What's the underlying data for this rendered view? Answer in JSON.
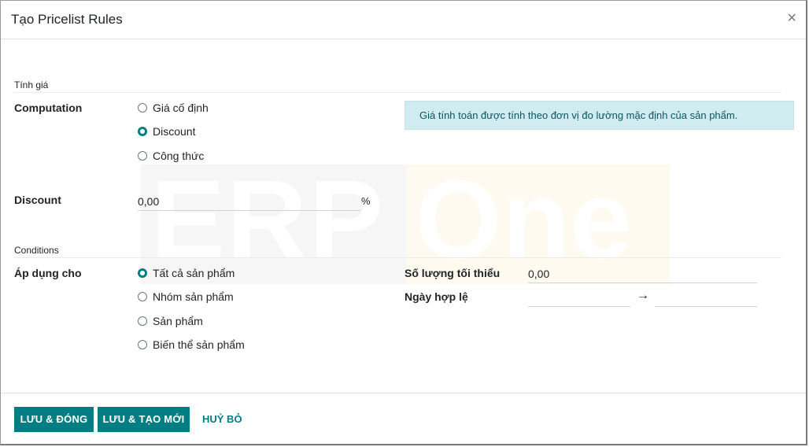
{
  "dialog": {
    "title": "Tạo Pricelist Rules",
    "close_glyph": "×"
  },
  "pricing": {
    "section_title": "Tính giá",
    "computation_label": "Computation",
    "options": [
      "Giá cố định",
      "Discount",
      "Công thức"
    ],
    "selected": "Discount",
    "info_text": "Giá tính toán được tính theo đơn vị đo lường mặc định của sản phẩm.",
    "discount_label": "Discount",
    "discount_value": "0,00",
    "discount_unit": "%"
  },
  "watermark": {
    "left": "ERP",
    "right": "One"
  },
  "conditions": {
    "section_title": "Conditions",
    "apply_label": "Áp dụng cho",
    "options": [
      "Tất cả sản phẩm",
      "Nhóm sản phẩm",
      "Sản phẩm",
      "Biến thể sản phẩm"
    ],
    "selected": "Tất cả sản phẩm",
    "min_qty_label": "Số lượng tối thiểu",
    "min_qty_value": "0,00",
    "validity_label": "Ngày hợp lệ",
    "date_start": "",
    "date_end": "",
    "date_arrow": "→"
  },
  "footer": {
    "save_close": "LƯU & ĐÓNG",
    "save_new": "LƯU & TẠO MỚI",
    "discard": "HUỶ BỎ"
  },
  "colors": {
    "primary": "#017e84",
    "info_bg": "#d1ecf1",
    "info_text": "#0c5460"
  }
}
